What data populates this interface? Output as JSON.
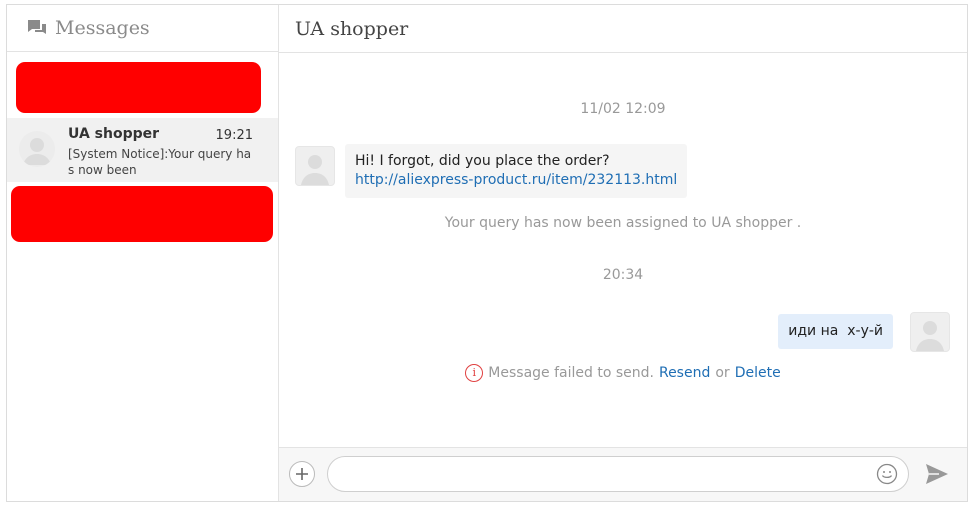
{
  "sidebar": {
    "title": "Messages",
    "title_icon": "chat-bubbles-icon",
    "conversation": {
      "name": "UA shopper",
      "time": "19:21",
      "preview": "[System Notice]:Your query has now been"
    }
  },
  "chat": {
    "title": "UA shopper",
    "time_sep_1": "11/02 12:09",
    "incoming_message": "Hi! I forgot, did you place the order?",
    "incoming_link": "http://aliexpress-product.ru/item/232113.html",
    "system_notice": "Your query has now been assigned to UA shopper .",
    "time_sep_2": "20:34",
    "outgoing_message": "иди на  х-у-й",
    "failed_text": "Message failed to send.",
    "resend_label": "Resend",
    "or_text": "or",
    "delete_label": "Delete"
  },
  "composer": {
    "placeholder": "",
    "add_icon": "plus-icon",
    "emoji_icon": "smiley-icon",
    "send_icon": "send-icon"
  },
  "colors": {
    "redaction": "#ff0000",
    "link": "#1f6eb4",
    "outgoing_bubble": "#e3eefb",
    "error": "#e04040"
  }
}
